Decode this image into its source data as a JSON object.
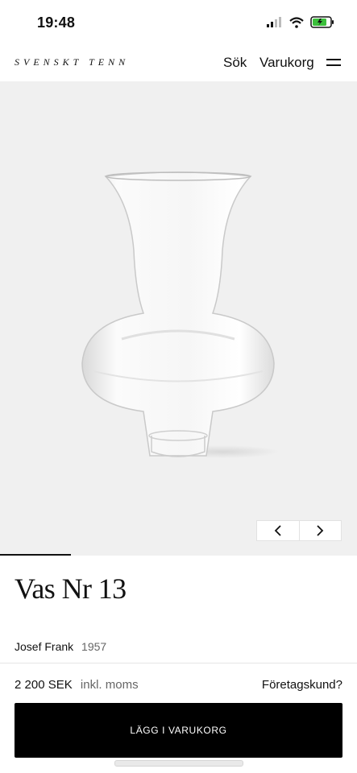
{
  "status_bar": {
    "time": "19:48",
    "icons": [
      "signal-icon",
      "wifi-icon",
      "battery-icon"
    ]
  },
  "header": {
    "logo": "SVENSKT TENN",
    "search_label": "Sök",
    "cart_label": "Varukorg",
    "menu_icon": "hamburger-menu-icon"
  },
  "product": {
    "title": "Vas Nr 13",
    "designer": "Josef Frank",
    "year": "1957",
    "price": "2 200 SEK",
    "tax_note": "inkl. moms",
    "business_link": "Företagskund?",
    "add_to_cart": "LÄGG I VARUKORG"
  },
  "carousel": {
    "prev_icon": "chevron-left-icon",
    "next_icon": "chevron-right-icon"
  },
  "colors": {
    "hero_background": "#f0f0f0",
    "button_background": "#000000",
    "button_text": "#ffffff"
  }
}
